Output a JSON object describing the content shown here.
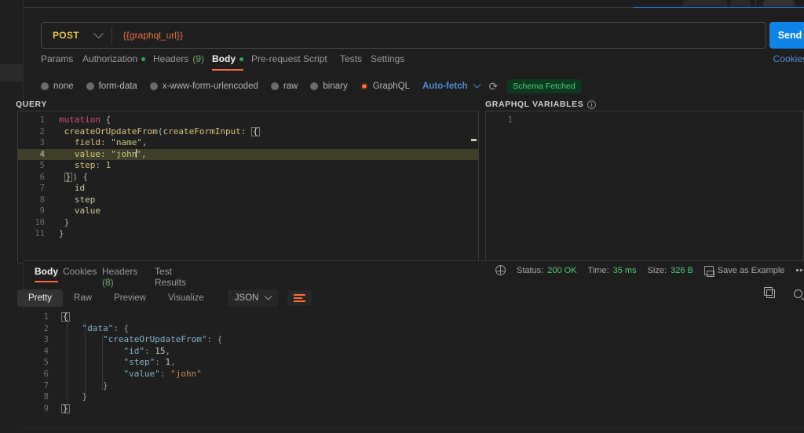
{
  "request": {
    "method": "POST",
    "url": "{{graphql_url}}",
    "send_label": "Send",
    "cookies_label": "Cookies",
    "tabs": [
      {
        "label": "Params",
        "dot": false,
        "count": null,
        "active": false
      },
      {
        "label": "Authorization",
        "dot": true,
        "count": null,
        "active": false
      },
      {
        "label": "Headers",
        "dot": false,
        "count": "(9)",
        "active": false
      },
      {
        "label": "Body",
        "dot": true,
        "count": null,
        "active": true
      },
      {
        "label": "Pre-request Script",
        "dot": false,
        "count": null,
        "active": false
      },
      {
        "label": "Tests",
        "dot": false,
        "count": null,
        "active": false
      },
      {
        "label": "Settings",
        "dot": false,
        "count": null,
        "active": false
      }
    ],
    "body_types": [
      {
        "label": "none",
        "selected": false
      },
      {
        "label": "form-data",
        "selected": false
      },
      {
        "label": "x-www-form-urlencoded",
        "selected": false
      },
      {
        "label": "raw",
        "selected": false
      },
      {
        "label": "binary",
        "selected": false
      },
      {
        "label": "GraphQL",
        "selected": true
      }
    ],
    "auto_fetch_label": "Auto-fetch",
    "refresh_icon": "refresh-icon",
    "schema_status": "Schema Fetched"
  },
  "query_panel": {
    "heading": "QUERY",
    "lines": [
      {
        "n": 1,
        "text": "mutation {"
      },
      {
        "n": 2,
        "text": "  createOrUpdateFrom(createFormInput: {"
      },
      {
        "n": 3,
        "text": "    field: \"name\","
      },
      {
        "n": 4,
        "text": "    value: \"john\",",
        "highlighted": true
      },
      {
        "n": 5,
        "text": "    step: 1"
      },
      {
        "n": 6,
        "text": "  }) {"
      },
      {
        "n": 7,
        "text": "    id"
      },
      {
        "n": 8,
        "text": "    step"
      },
      {
        "n": 9,
        "text": "    value"
      },
      {
        "n": 10,
        "text": "  }"
      },
      {
        "n": 11,
        "text": "}"
      }
    ]
  },
  "variables_panel": {
    "heading": "GRAPHQL VARIABLES",
    "info_icon": "info-icon",
    "lines": [
      {
        "n": 1,
        "text": ""
      }
    ]
  },
  "response": {
    "tabs": [
      {
        "label": "Body",
        "count": null,
        "active": true
      },
      {
        "label": "Cookies",
        "count": null,
        "active": false
      },
      {
        "label": "Headers",
        "count": "(8)",
        "active": false
      },
      {
        "label": "Test Results",
        "count": null,
        "active": false
      }
    ],
    "status_label": "Status:",
    "status_value": "200 OK",
    "time_label": "Time:",
    "time_value": "35 ms",
    "size_label": "Size:",
    "size_value": "326 B",
    "save_example_label": "Save as Example",
    "more_label": "•••",
    "view_modes": [
      {
        "label": "Pretty",
        "active": true
      },
      {
        "label": "Raw",
        "active": false
      },
      {
        "label": "Preview",
        "active": false
      },
      {
        "label": "Visualize",
        "active": false
      }
    ],
    "format": "JSON",
    "wrap_icon": "wrap-lines-icon",
    "copy_icon": "copy-icon",
    "search_icon": "search-icon",
    "body_lines": [
      {
        "n": 1,
        "text": "{"
      },
      {
        "n": 2,
        "text": "    \"data\": {"
      },
      {
        "n": 3,
        "text": "        \"createOrUpdateFrom\": {"
      },
      {
        "n": 4,
        "text": "            \"id\": 15,"
      },
      {
        "n": 5,
        "text": "            \"step\": 1,"
      },
      {
        "n": 6,
        "text": "            \"value\": \"john\""
      },
      {
        "n": 7,
        "text": "        }"
      },
      {
        "n": 8,
        "text": "    }"
      },
      {
        "n": 9,
        "text": "}"
      }
    ]
  },
  "colors": {
    "accent": "#ff6c37",
    "send": "#0e84e8",
    "success": "#4fcc7a",
    "link": "#4a8bd8",
    "method": "#e8c547",
    "url": "#e8703a"
  }
}
